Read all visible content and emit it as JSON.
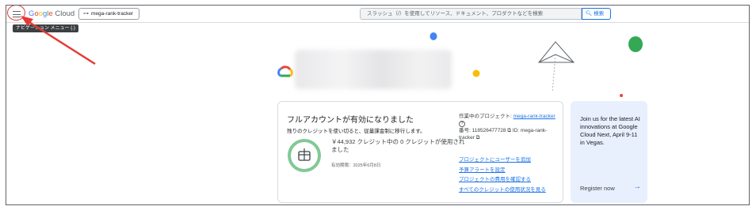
{
  "topbar": {
    "logo_google": "Google",
    "logo_cloud": "Cloud",
    "project_chip_label": "mega-rank-tracker",
    "search_placeholder": "スラッシュ（/）を使用してリソース、ドキュメント、プロダクトなどを検索",
    "search_button_label": "検索",
    "tooltip": "ナビゲーション メニュー (.)"
  },
  "colors": {
    "accent_blue": "#1a73e8",
    "annotation_red": "#e53935",
    "gauge_green": "#81c995",
    "promo_bg": "#e8f0fe"
  },
  "credit_card": {
    "title": "フルアカウントが有効になりました",
    "subtitle": "残りのクレジットを使い切ると、従量課金制に移行します。",
    "credit_text": "￥44,932 クレジット中の 0 クレジットが使用されました",
    "expiry": "有効期限：2025年6月8日",
    "gauge_used_fraction": 0.0,
    "project_label": "作業中のプロジェクト:",
    "project_name": "mega-rank-tracker",
    "help_icon": "?",
    "project_number_label": "番号: 118526477728",
    "project_id_label": "ID: mega-rank-tracker",
    "links": [
      "プロジェクトにユーザーを追加",
      "予算アラートを設定",
      "プロジェクトの費用を確認する",
      "すべてのクレジットの使用状況を見る"
    ]
  },
  "promo": {
    "text": "Join us for the latest AI innovations at Google Cloud Next, April 9-11 in Vegas.",
    "cta": "Register now",
    "cta_arrow": "→"
  },
  "icons": {
    "menu": "hamburger-icon",
    "project": "project-tree-icon",
    "search": "search-icon",
    "copy": "copy-icon",
    "gift": "gift-icon"
  }
}
